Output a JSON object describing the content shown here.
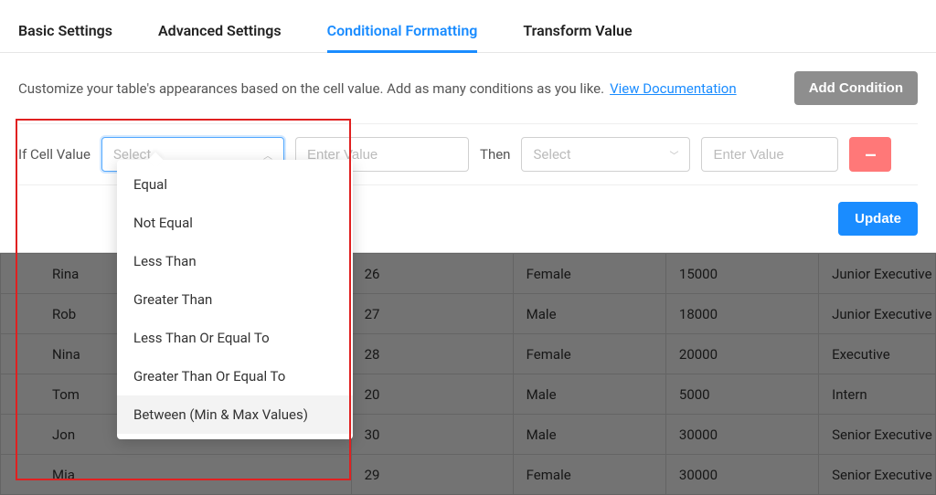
{
  "tabs": {
    "basic": "Basic Settings",
    "advanced": "Advanced Settings",
    "conditional": "Conditional Formatting",
    "transform": "Transform Value",
    "active": "conditional"
  },
  "intro": {
    "text": "Customize your table's appearances based on the cell value. Add as many conditions as you like.",
    "doc_link": "View Documentation",
    "add_button": "Add Condition"
  },
  "condition": {
    "if_label": "If Cell Value",
    "operator_placeholder": "Select",
    "value_placeholder": "Enter Value",
    "then_label": "Then",
    "action_placeholder": "Select",
    "action_value_placeholder": "Enter Value",
    "remove_label": "–",
    "update_button": "Update"
  },
  "dropdown": {
    "options": [
      "Equal",
      "Not Equal",
      "Less Than",
      "Greater Than",
      "Less Than Or Equal To",
      "Greater Than Or Equal To",
      "Between (Min & Max Values)"
    ],
    "hover_index": 6
  },
  "table": {
    "rows": [
      {
        "name": "Rina",
        "age": "26",
        "gender": "Female",
        "salary": "15000",
        "role": "Junior Executive"
      },
      {
        "name": "Rob",
        "age": "27",
        "gender": "Male",
        "salary": "18000",
        "role": "Junior Executive"
      },
      {
        "name": "Nina",
        "age": "28",
        "gender": "Female",
        "salary": "20000",
        "role": "Executive"
      },
      {
        "name": "Tom",
        "age": "20",
        "gender": "Male",
        "salary": "5000",
        "role": "Intern"
      },
      {
        "name": "Jon",
        "age": "30",
        "gender": "Male",
        "salary": "30000",
        "role": "Senior Executive"
      },
      {
        "name": "Mia",
        "age": "29",
        "gender": "Female",
        "salary": "30000",
        "role": "Senior Executive"
      }
    ]
  }
}
